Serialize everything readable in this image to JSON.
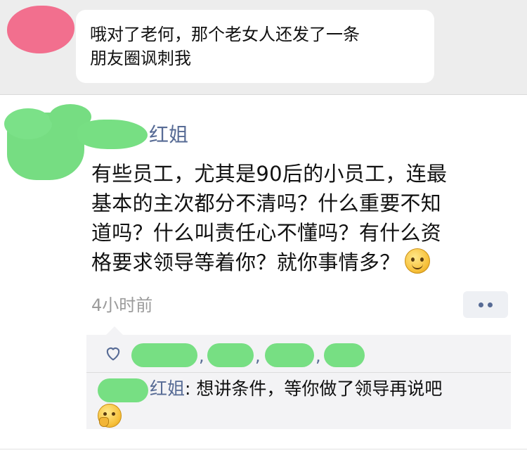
{
  "chat": {
    "message_line1": "哦对了老何，那个老女人还发了一条",
    "message_line2": "朋友圈讽刺我"
  },
  "post": {
    "author_suffix": "红姐",
    "text_line1": "有些员工，尤其是90后的小员工，连最",
    "text_line2": "基本的主次都分不清吗？什么重要不知",
    "text_line3": "道吗？什么叫责任心不懂吗？有什么资",
    "text_line4": "格要求领导等着你？就你事情多？",
    "time": "4小时前",
    "more_icon": "more-dots-icon",
    "emoji_icon": "smile-emoji-icon"
  },
  "likes": {
    "icon": "heart-icon",
    "separators": [
      ",",
      ",",
      ","
    ]
  },
  "comments": [
    {
      "author_suffix": "红姐",
      "colon": ":",
      "text": "想讲条件，等你做了领导再说吧",
      "emoji_icon": "thinking-emoji-icon"
    }
  ],
  "colors": {
    "link": "#576b95",
    "redaction": "#77df83",
    "avatar_pink": "#f26f8e",
    "chat_bg": "#ededed"
  }
}
